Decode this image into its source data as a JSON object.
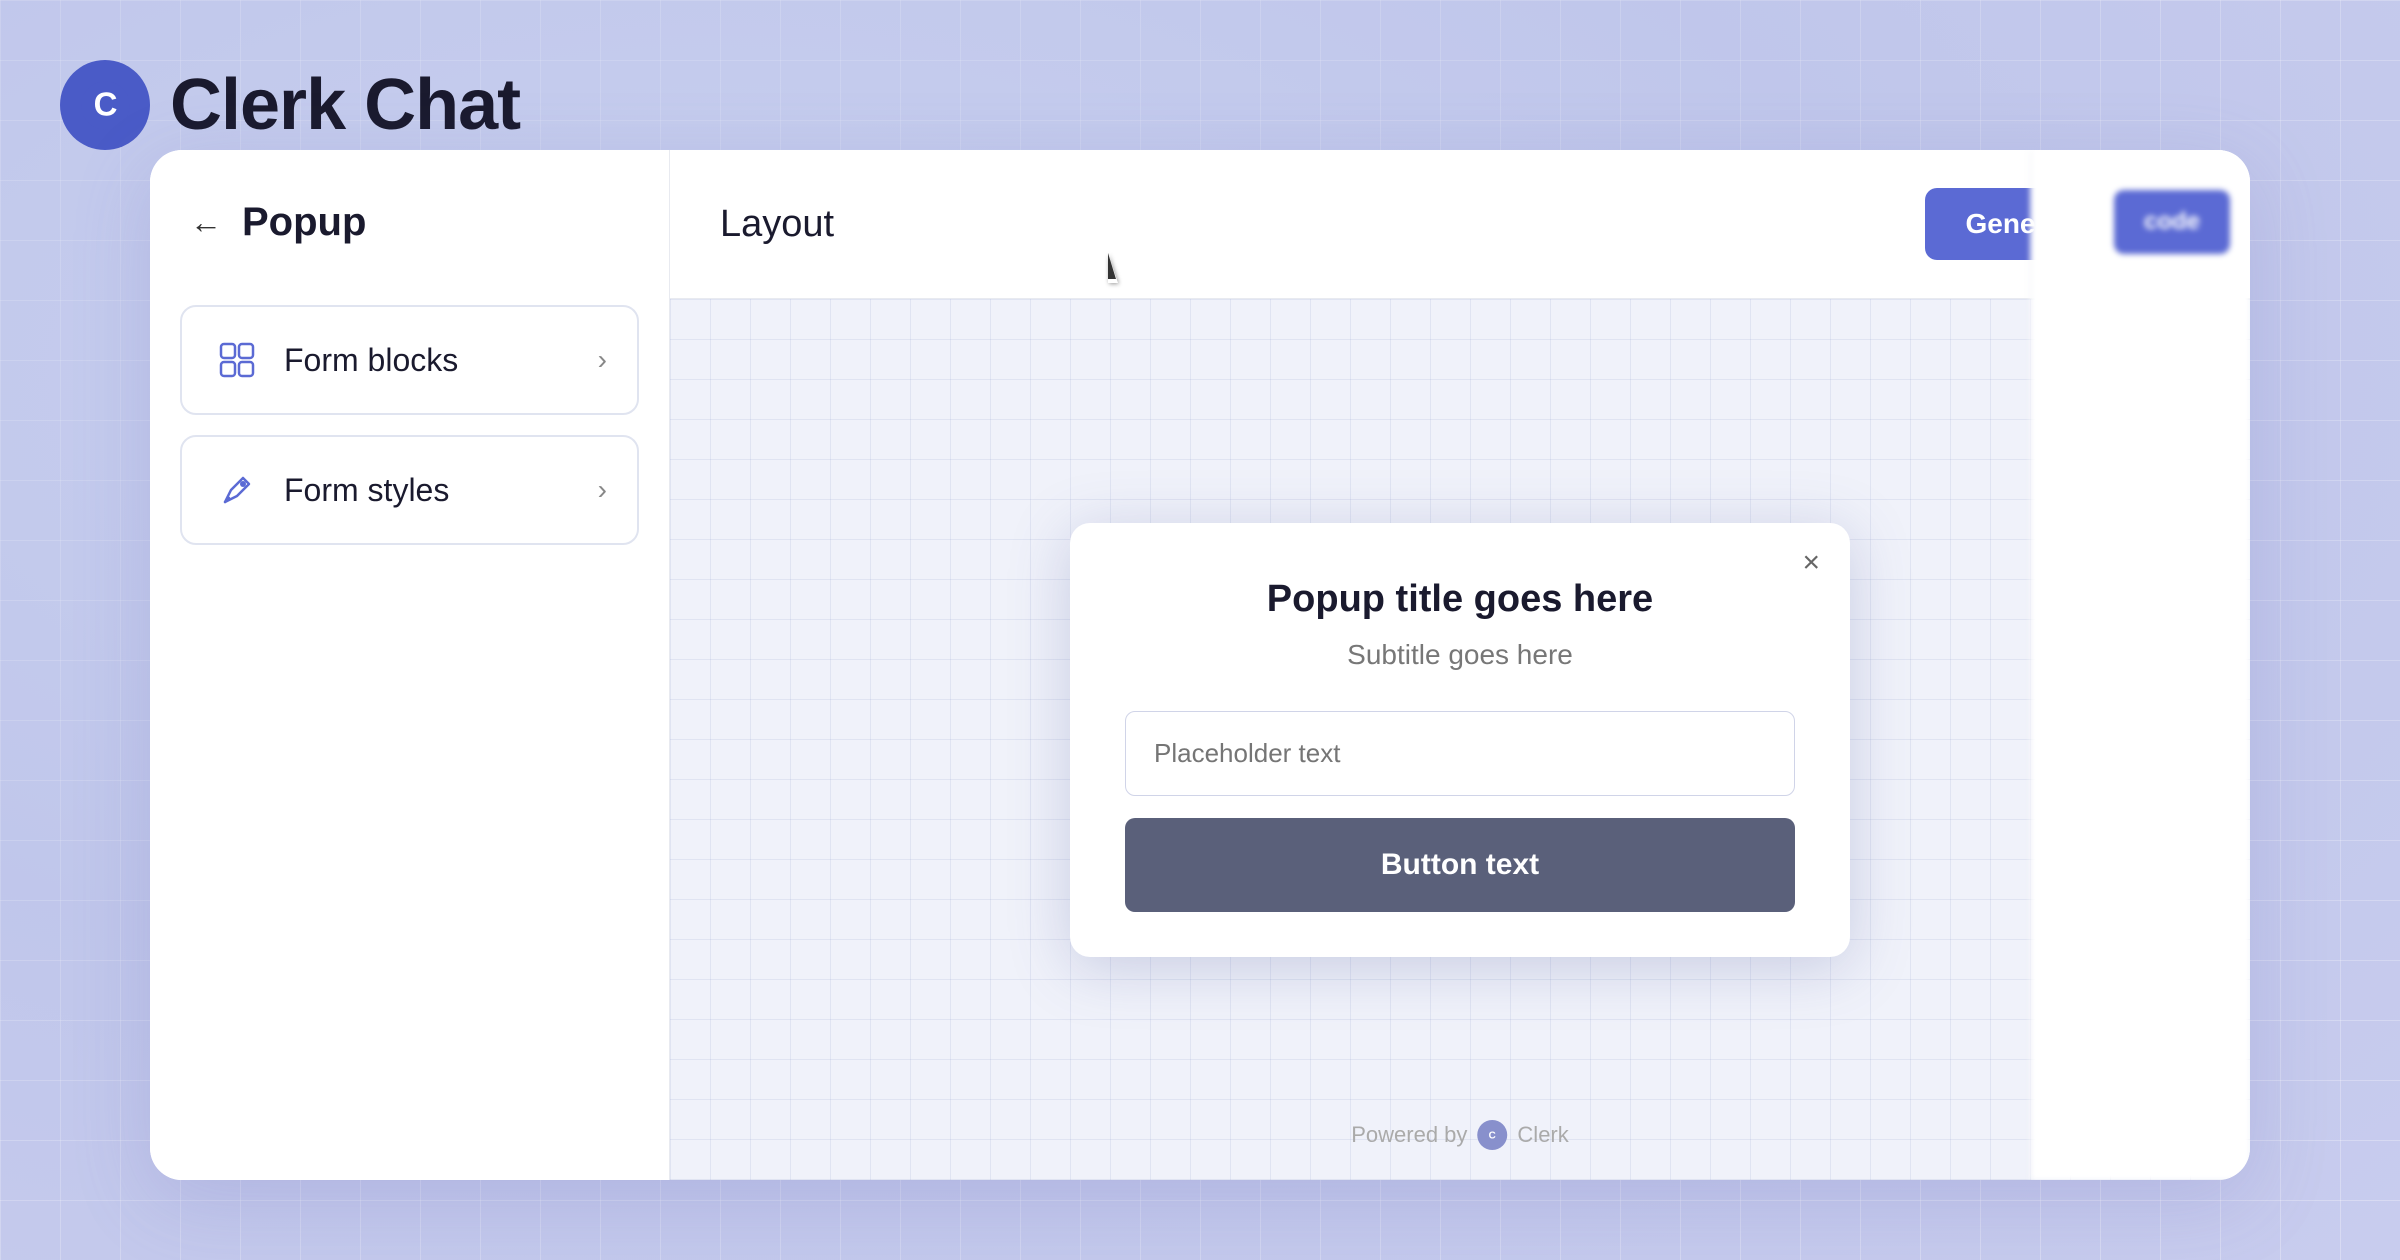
{
  "app": {
    "title": "Clerk Chat",
    "logo_letter": "C"
  },
  "sidebar": {
    "back_label": "←",
    "title": "Popup",
    "items": [
      {
        "id": "form-blocks",
        "label": "Form blocks",
        "icon": "form-blocks-icon"
      },
      {
        "id": "form-styles",
        "label": "Form styles",
        "icon": "form-styles-icon"
      }
    ]
  },
  "content": {
    "header_title": "Layout",
    "generate_btn_label": "Generate code"
  },
  "popup": {
    "title": "Popup title goes here",
    "subtitle": "Subtitle goes here",
    "input_placeholder": "Placeholder text",
    "button_label": "Button text",
    "close_label": "×"
  },
  "footer": {
    "powered_by_text": "Powered by",
    "brand_name": "Clerk"
  },
  "colors": {
    "brand_blue": "#5b6ad4",
    "button_dark": "#5a607a",
    "bg_grid": "#c8ccee"
  }
}
